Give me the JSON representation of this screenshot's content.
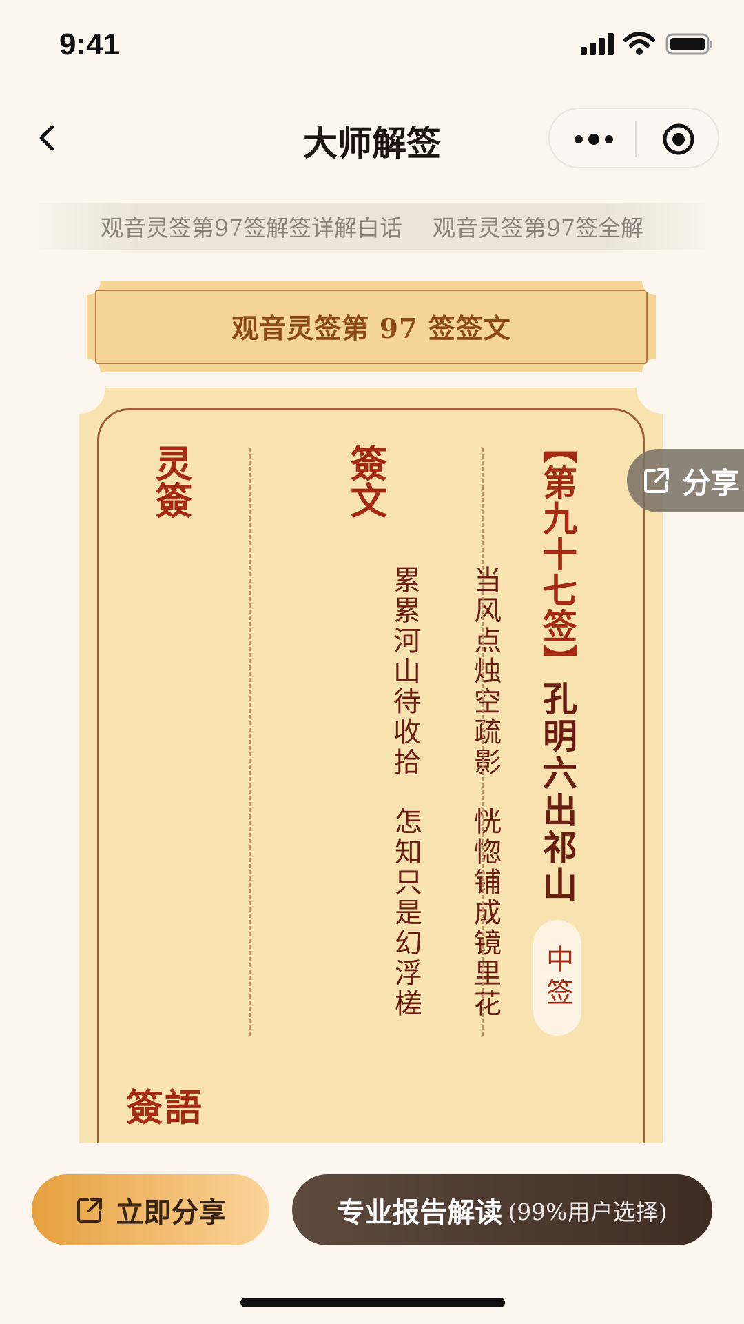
{
  "status_bar": {
    "time": "9:41"
  },
  "nav": {
    "title": "大师解签"
  },
  "headlines": [
    "观音灵签第97签解签详解白话",
    "观音灵签第97签全解"
  ],
  "banner": {
    "title": "观音灵签第 97 签签文"
  },
  "card": {
    "lingqian_heading": "灵簽",
    "qianwen_heading": "簽文",
    "poem_lines": [
      "累累河山待收拾",
      "怎知只是幻浮槎",
      "当风点烛空疏影",
      "恍惚铺成镜里花"
    ],
    "number_label": "【第九十七签】",
    "name": "孔明六出祁山",
    "grade": "中签",
    "qianyu_heading": "簽語"
  },
  "float_share": {
    "label": "分享"
  },
  "bottom": {
    "share_label": "立即分享",
    "report_label": "专业报告解读",
    "report_sub": "(99%用户选择)"
  },
  "colors": {
    "background": "#fcf6ee",
    "card": "#f8e2b0",
    "accent_red": "#a52a13",
    "gold": "#e6a03e",
    "dark_button": "#4e3a30"
  },
  "icons": [
    "back-icon",
    "more-icon",
    "target-icon",
    "share-icon",
    "signal-icon",
    "wifi-icon",
    "battery-icon"
  ]
}
